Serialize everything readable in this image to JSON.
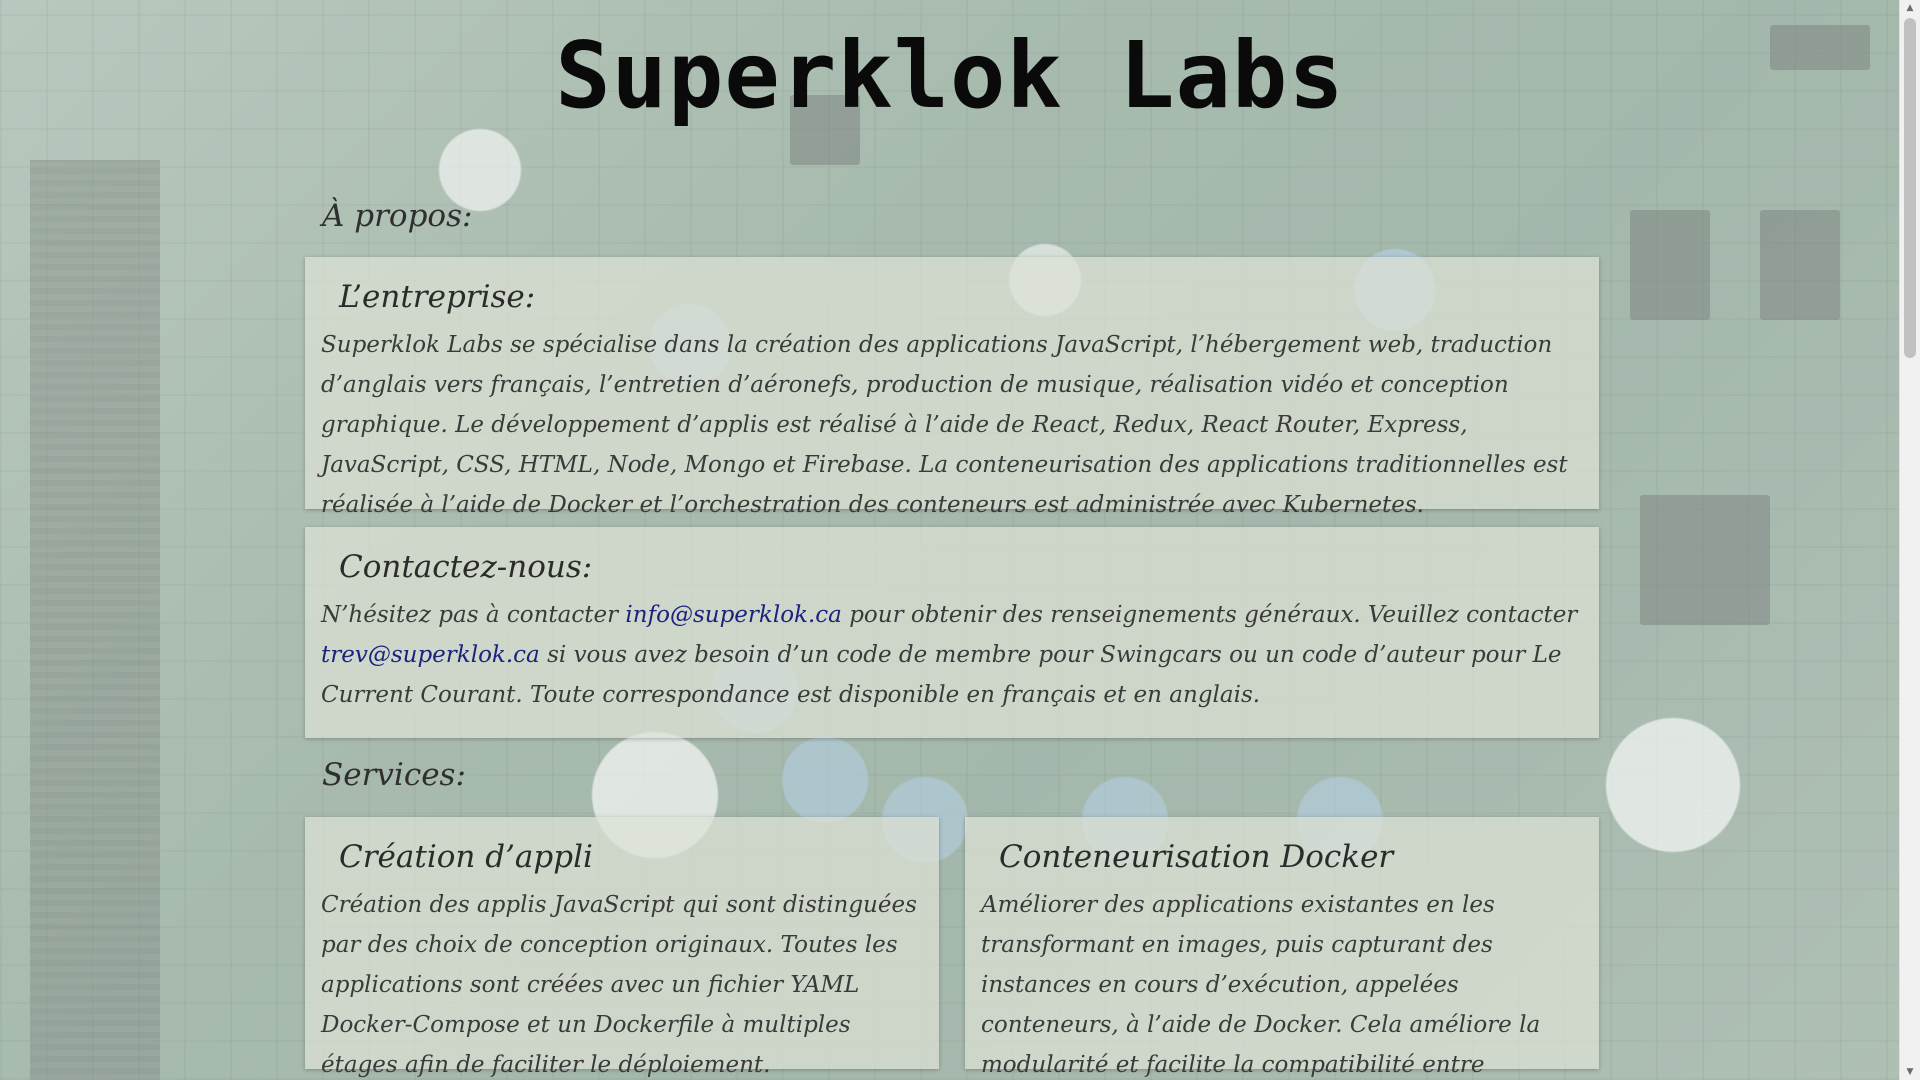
{
  "site": {
    "title": "Superklok Labs"
  },
  "about": {
    "heading": "À propos:",
    "company": {
      "title": "L’entreprise:",
      "text": "Superklok Labs se spécialise dans la création des applications JavaScript, l’hébergement web, traduction d’anglais vers français, l’entretien d’aéronefs, production de musique, réalisation vidéo et conception graphique. Le développement d’applis est réalisé à l’aide de React, Redux, React Router, Express, JavaScript, CSS, HTML, Node, Mongo et Firebase. La conteneurisation des applications traditionnelles est réalisée à l’aide de Docker et l’orchestration des conteneurs est administrée avec Kubernetes."
    },
    "contact": {
      "title": "Contactez-nous:",
      "text_1": "N’hésitez pas à contacter ",
      "email_1": "info@superklok.ca",
      "text_2": " pour obtenir des renseignements généraux. Veuillez contacter ",
      "email_2": "trev@superklok.ca",
      "text_3": " si vous avez besoin d’un code de membre pour Swingcars ou un code d’auteur pour Le Current Courant. Toute correspondance est disponible en français et en anglais."
    }
  },
  "services": {
    "heading": "Services:",
    "items": [
      {
        "title": "Création d’appli",
        "text": "Création des applis JavaScript qui sont distinguées par des choix de conception originaux. Toutes les applications sont créées avec un fichier YAML Docker-Compose et un Dockerfile à multiples étages afin de faciliter le déploiement."
      },
      {
        "title": "Conteneurisation Docker",
        "text": "Améliorer des applications existantes en les transformant en images, puis capturant des instances en cours d’exécution, appelées conteneurs, à l’aide de Docker. Cela améliore la modularité et facilite la compatibilité entre plateformes."
      }
    ]
  },
  "scrollbar": {
    "up_arrow": "▲",
    "down_arrow": "▼"
  }
}
